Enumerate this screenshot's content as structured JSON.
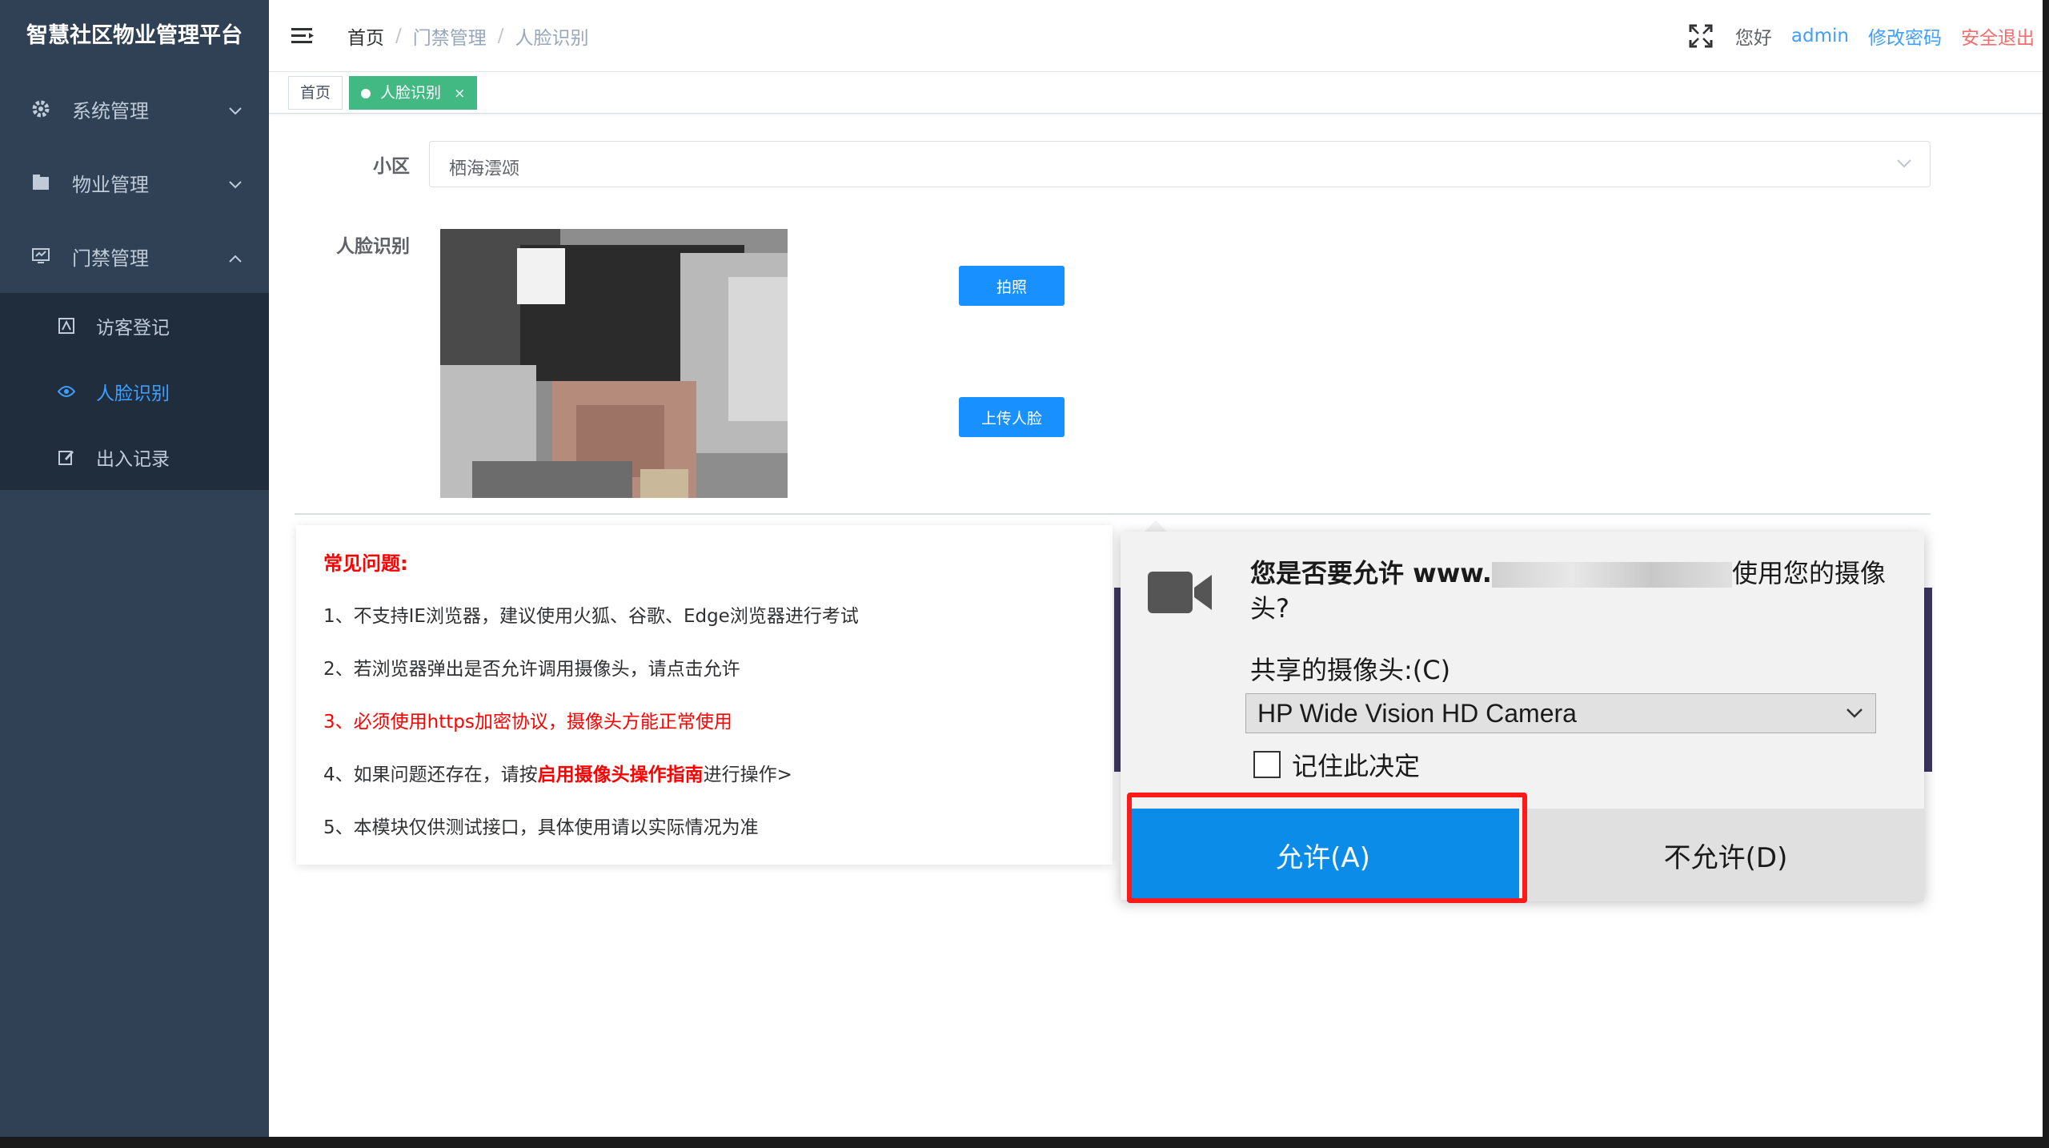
{
  "sidebar": {
    "brand": "智慧社区物业管理平台",
    "menus": [
      {
        "label": "系统管理",
        "icon": "gear-icon",
        "expanded": false
      },
      {
        "label": "物业管理",
        "icon": "building-icon",
        "expanded": false
      },
      {
        "label": "门禁管理",
        "icon": "monitor-icon",
        "expanded": true
      }
    ],
    "submenu": [
      {
        "label": "访客登记",
        "icon": "visitor-icon",
        "active": false
      },
      {
        "label": "人脸识别",
        "icon": "eye-icon",
        "active": true
      },
      {
        "label": "出入记录",
        "icon": "edit-icon",
        "active": false
      }
    ]
  },
  "header": {
    "breadcrumb": [
      "首页",
      "门禁管理",
      "人脸识别"
    ],
    "hello": "您好",
    "username": "admin",
    "change_password": "修改密码",
    "logout": "安全退出"
  },
  "tags": {
    "home": "首页",
    "active": "人脸识别",
    "close": "×"
  },
  "form": {
    "community_label": "小区",
    "community_value": "栖海澐颂",
    "face_label": "人脸识别",
    "capture_button": "拍照",
    "upload_button": "上传人脸"
  },
  "faq": {
    "title": "常见问题:",
    "item1": "1、不支持IE浏览器，建议使用火狐、谷歌、Edge浏览器进行考试",
    "item2": "2、若浏览器弹出是否允许调用摄像头，请点击允许",
    "item3": "3、必须使用https加密协议，摄像头方能正常使用",
    "item4_prefix": "4、如果问题还存在，请按",
    "item4_link": "启用摄像头操作指南",
    "item4_suffix": "进行操作>",
    "item5": "5、本模块仅供测试接口，具体使用请以实际情况为准"
  },
  "dialog": {
    "msg_prefix": "您是否要允许 www.",
    "msg_suffix": "使用您的摄像头?",
    "share_label": "共享的摄像头:(C)",
    "camera": "HP Wide Vision HD Camera",
    "remember": "记住此决定",
    "allow": "允许(A)",
    "deny": "不允许(D)"
  },
  "colors": {
    "sidebar_bg": "#304156",
    "primary": "#409eff",
    "tag_active": "#42b983",
    "danger": "#ff0000",
    "allow_button": "#0c8ce9",
    "highlight": "#ff1a1a"
  }
}
